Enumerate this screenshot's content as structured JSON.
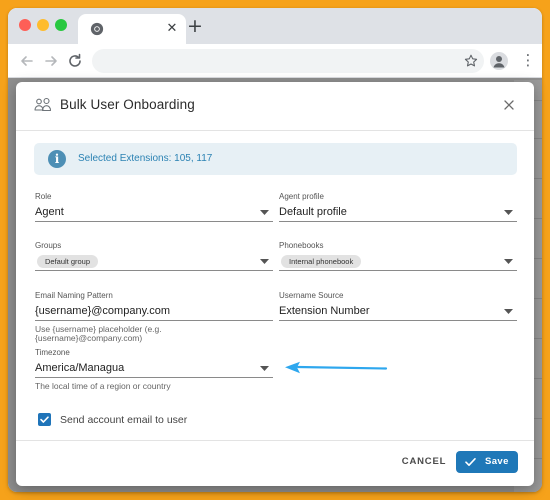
{
  "browser": {
    "tab_close_glyph": "✕",
    "new_tab_glyph": "+",
    "menu_glyph": "⋮"
  },
  "dialog": {
    "title": "Bulk User Onboarding",
    "info_text": "Selected Extensions: 105, 117",
    "info_icon_glyph": "i",
    "fields": {
      "role": {
        "label": "Role",
        "value": "Agent"
      },
      "agent_profile": {
        "label": "Agent profile",
        "value": "Default profile"
      },
      "groups": {
        "label": "Groups",
        "chip": "Default group"
      },
      "phonebooks": {
        "label": "Phonebooks",
        "chip": "Internal phonebook"
      },
      "email_pattern": {
        "label": "Email Naming Pattern",
        "value": "{username}@company.com",
        "helper_line1": "Use {username} placeholder (e.g.",
        "helper_line2": "{username}@company.com)"
      },
      "username_source": {
        "label": "Username Source",
        "value": "Extension Number"
      },
      "timezone": {
        "label": "Timezone",
        "value": "America/Managua",
        "helper": "The local time of a region or country"
      }
    },
    "checkbox": {
      "label": "Send account email to user",
      "checked": true
    },
    "buttons": {
      "cancel": "Cancel",
      "save": "Save"
    }
  },
  "icons": {
    "header": "users-icon",
    "close": "close-icon",
    "info": "info-icon",
    "caret": "chevron-down-icon",
    "check": "check-icon"
  },
  "colors": {
    "background": "#f6a21a",
    "accent": "#1f78b8",
    "info_bg": "#e7f0f5",
    "info_text": "#2b82b3",
    "arrow": "#2ea7ee"
  }
}
